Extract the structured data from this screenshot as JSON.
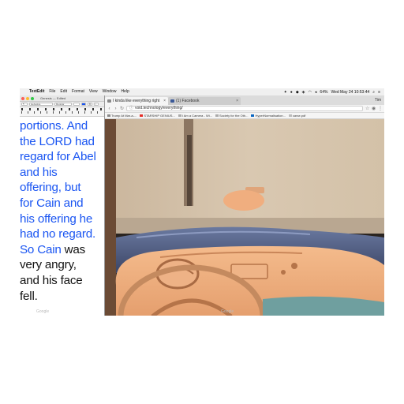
{
  "menubar": {
    "app": "TextEdit",
    "menus": [
      "File",
      "Edit",
      "Format",
      "View",
      "Window",
      "Help"
    ],
    "clock": "Wed May 24  10:53:44",
    "battery": "64%",
    "status_icons": [
      "dropbox-icon",
      "record-icon",
      "shield-icon",
      "bell-icon",
      "wifi-icon",
      "volume-icon",
      "bluetooth-icon",
      "search-icon",
      "list-icon"
    ]
  },
  "textedit": {
    "title": "Genesis — Edited",
    "font_style": "Helvetica",
    "font_weight": "Regular",
    "lines": [
      {
        "text": "portions. And",
        "color": "blue"
      },
      {
        "text": "the LORD had",
        "color": "blue"
      },
      {
        "text": "regard for Abel",
        "color": "blue"
      },
      {
        "text": "and his",
        "color": "blue"
      },
      {
        "text": "offering, but",
        "color": "blue"
      },
      {
        "text": "for Cain and",
        "color": "blue"
      },
      {
        "text": "his offering he",
        "color": "blue"
      },
      {
        "text": "had no regard.",
        "color": "blue"
      }
    ],
    "line9_blue": "So Cain",
    "line9_black": " was",
    "line10": "very angry,",
    "line11": "and his face",
    "line12": "fell."
  },
  "browser": {
    "tabs": [
      {
        "label": "I kinda like everything right"
      },
      {
        "label": "(1) Facebook"
      }
    ],
    "profile": "Tim",
    "url": "void.technology/everything/",
    "bookmarks": [
      "Trump At Mar-a-...",
      "STARSHIP GENIUS...",
      "I Am a Camera - Wi...",
      "Society for the Oth...",
      "HyperNormalisation...",
      "carse.pdf"
    ]
  },
  "colors": {
    "text_blue": "#1a55f2",
    "wall": "#d8c7b0",
    "dashboard": "#f0b07e"
  },
  "dock_labels": [
    "Google",
    "Google"
  ]
}
